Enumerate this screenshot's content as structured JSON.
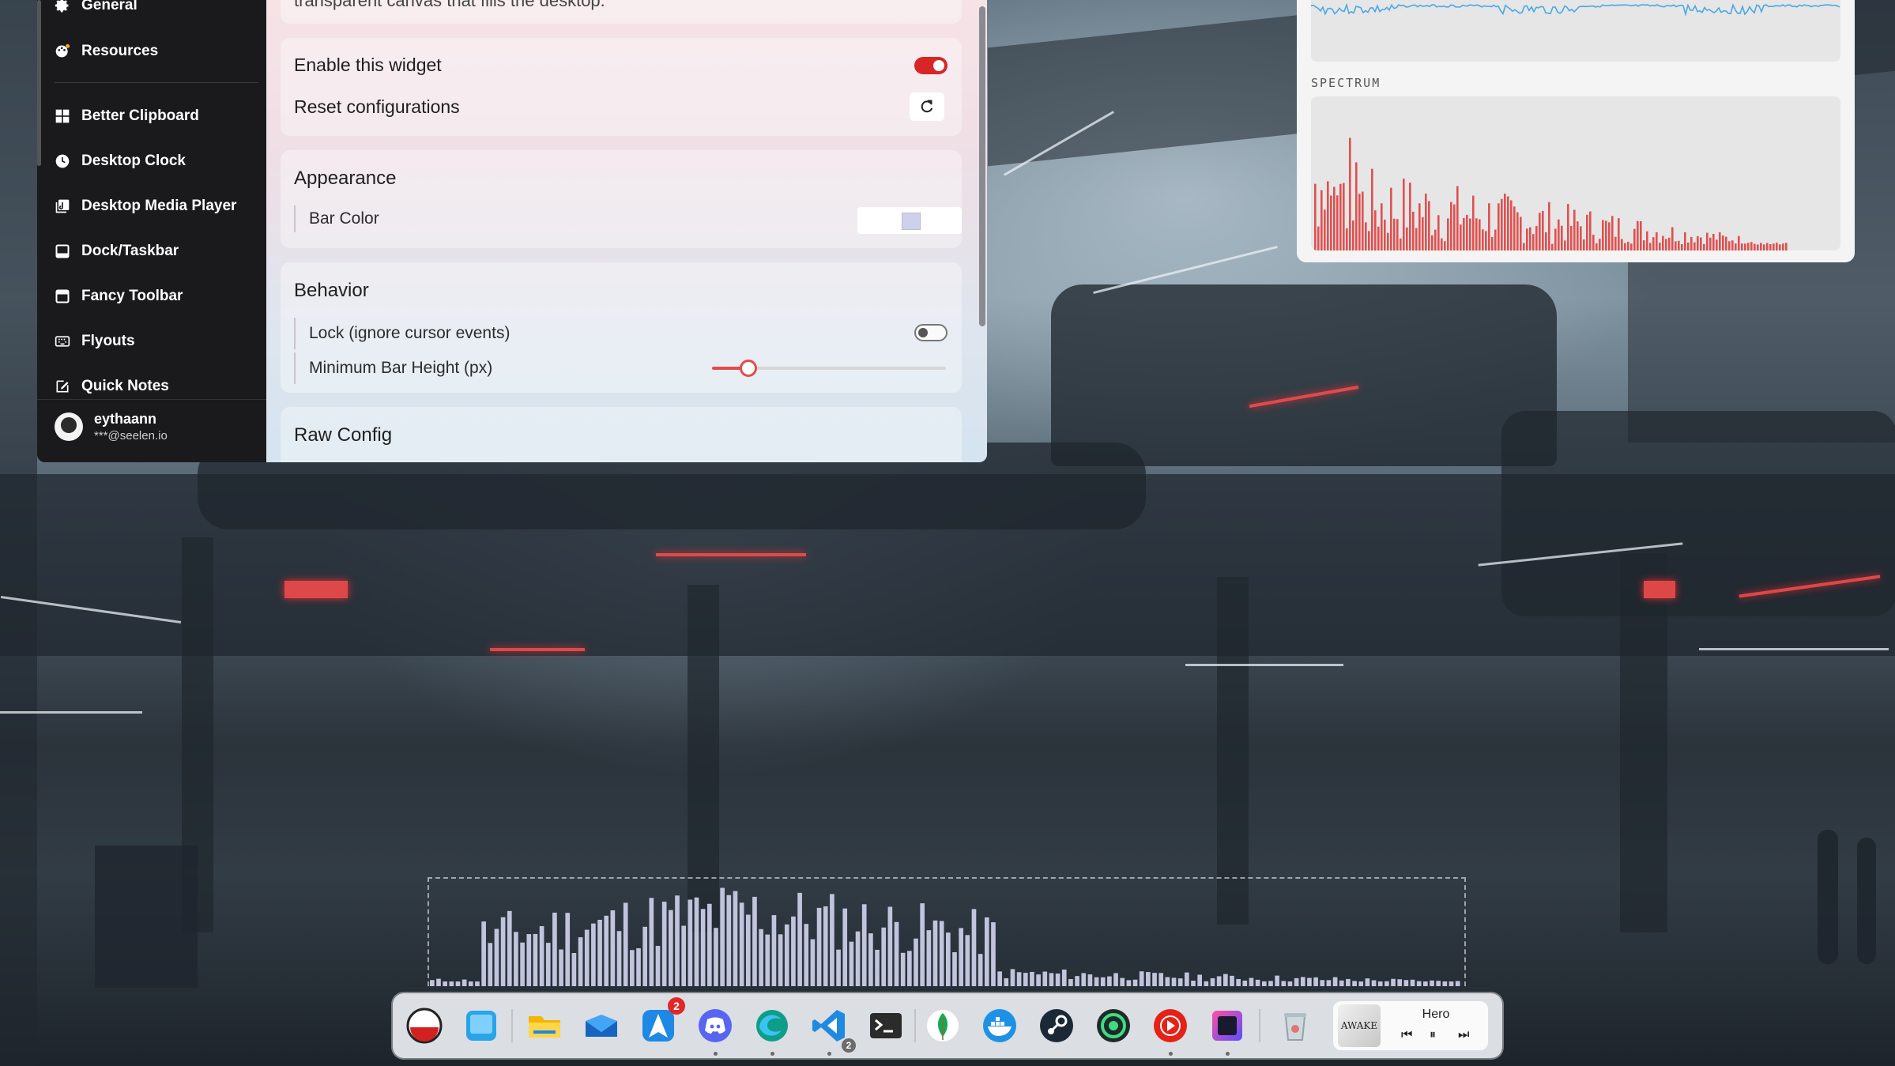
{
  "sidebar": {
    "items": [
      {
        "label": "General",
        "icon": "gear-icon"
      },
      {
        "label": "Resources",
        "icon": "palette-icon"
      },
      {
        "label": "Better Clipboard",
        "icon": "grid-icon"
      },
      {
        "label": "Desktop Clock",
        "icon": "clock-icon"
      },
      {
        "label": "Desktop Media Player",
        "icon": "media-icon"
      },
      {
        "label": "Dock/Taskbar",
        "icon": "dock-icon"
      },
      {
        "label": "Fancy Toolbar",
        "icon": "toolbar-icon"
      },
      {
        "label": "Flyouts",
        "icon": "keyboard-icon"
      },
      {
        "label": "Quick Notes",
        "icon": "note-icon"
      }
    ],
    "user": {
      "name": "eythaann",
      "email": "***@seelen.io"
    }
  },
  "settings": {
    "intro_text": "transparent canvas that fills the desktop.",
    "enable_label": "Enable this widget",
    "enable_on": true,
    "reset_label": "Reset configurations",
    "appearance": {
      "title": "Appearance",
      "bar_color_label": "Bar Color",
      "bar_color": "#cfd0ea"
    },
    "behavior": {
      "title": "Behavior",
      "lock_label": "Lock (ignore cursor events)",
      "lock_on": false,
      "min_bar_label": "Minimum Bar Height (px)",
      "min_bar_fraction": 0.15
    },
    "raw_config_title": "Raw Config"
  },
  "widget": {
    "spectrum_label": "SPECTRUM"
  },
  "colors": {
    "accent": "#d72626",
    "spectrum_bar": "#e05050",
    "wave": "#4aa8e8"
  },
  "dock": {
    "items": [
      {
        "name": "seelen-ui",
        "icon": "seelen-icon"
      },
      {
        "name": "desktop",
        "icon": "desktop-icon"
      },
      {
        "name": "file-explorer",
        "icon": "folder-icon"
      },
      {
        "name": "mail",
        "icon": "mail-icon"
      },
      {
        "name": "navigator",
        "icon": "arrow-app-icon",
        "badge": "2"
      },
      {
        "name": "discord",
        "icon": "discord-icon"
      },
      {
        "name": "edge",
        "icon": "edge-icon"
      },
      {
        "name": "vscode",
        "icon": "vscode-icon",
        "badge_small": "2"
      },
      {
        "name": "terminal",
        "icon": "terminal-icon"
      },
      {
        "name": "mongodb",
        "icon": "leaf-icon"
      },
      {
        "name": "docker",
        "icon": "docker-icon"
      },
      {
        "name": "steam",
        "icon": "steam-icon"
      },
      {
        "name": "app-green",
        "icon": "green-circle-icon"
      },
      {
        "name": "youtube-music",
        "icon": "play-icon"
      },
      {
        "name": "screen-app",
        "icon": "gradient-square-icon"
      },
      {
        "name": "recycle-bin",
        "icon": "trash-icon"
      }
    ],
    "media": {
      "title": "Hero",
      "art_text": "AWAKE"
    }
  }
}
